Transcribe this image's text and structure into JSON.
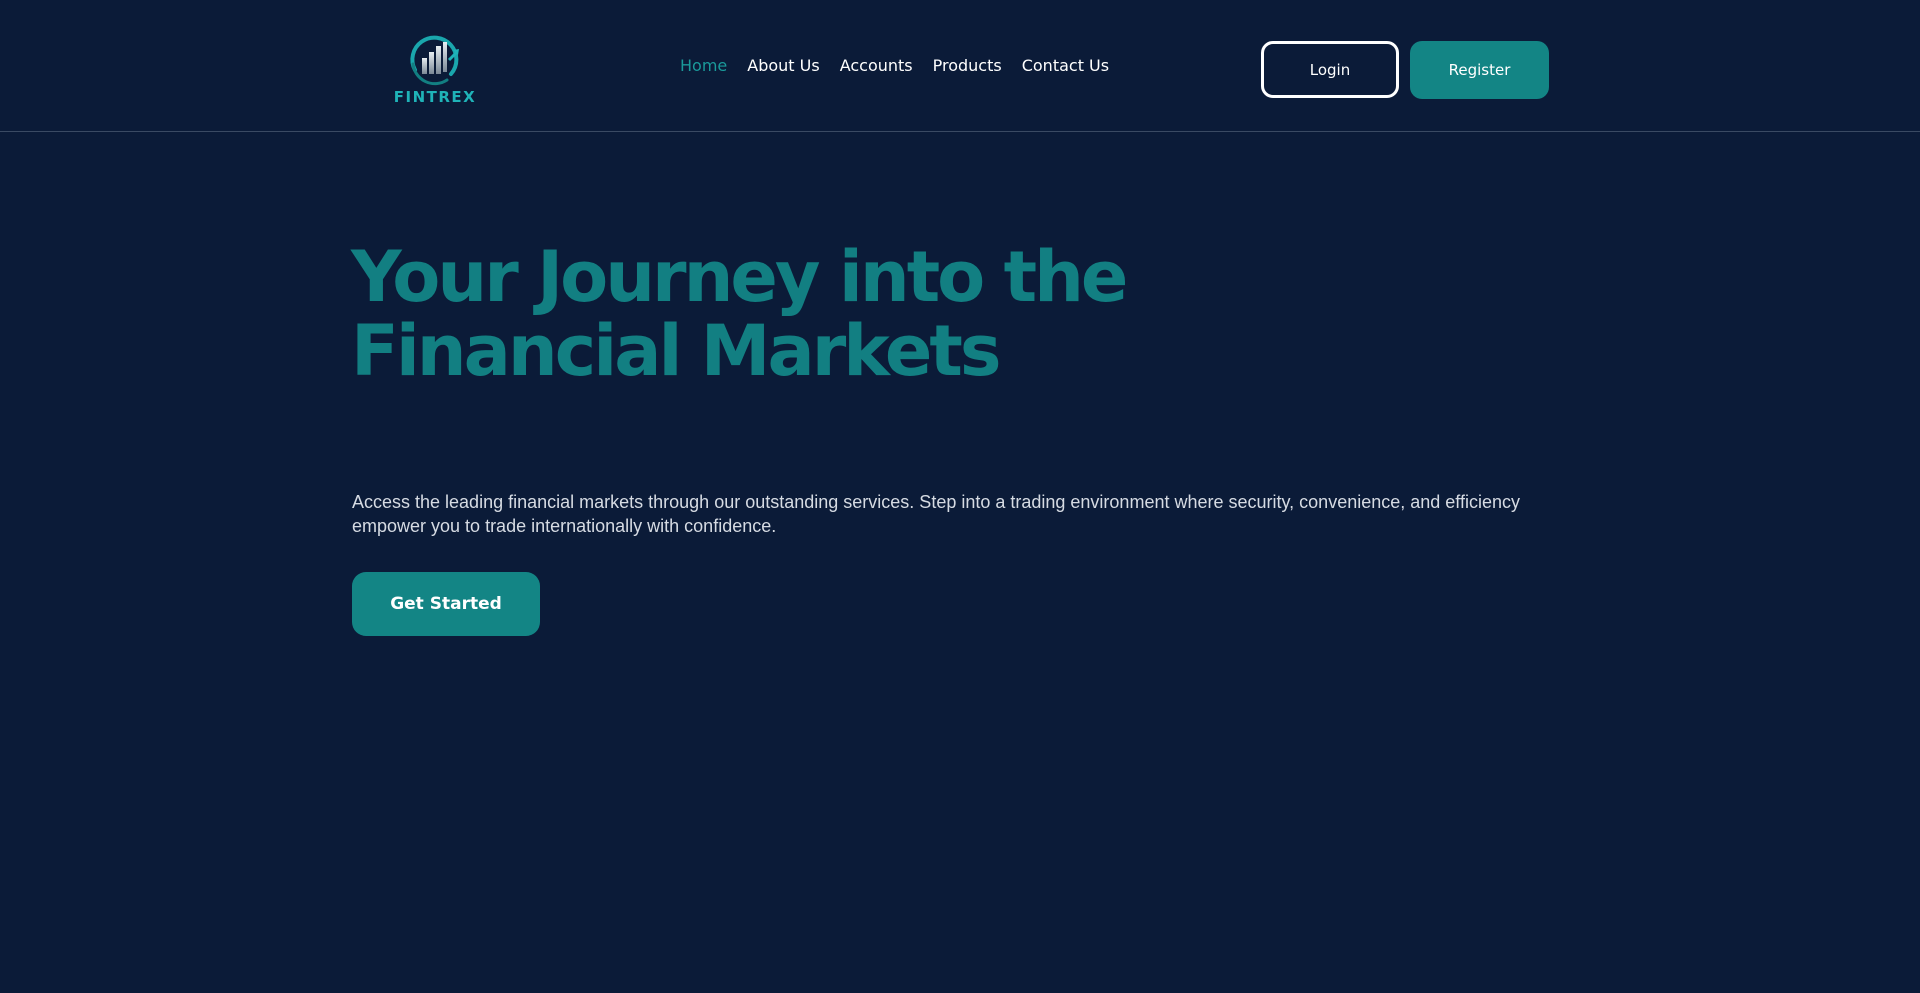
{
  "brand": {
    "name": "FINTREX",
    "logo_icon": "chart-growth-icon",
    "accent_color": "#1fb3b8"
  },
  "nav": {
    "items": [
      {
        "label": "Home",
        "active": true
      },
      {
        "label": "About Us",
        "active": false
      },
      {
        "label": "Accounts",
        "active": false
      },
      {
        "label": "Products",
        "active": false
      },
      {
        "label": "Contact Us",
        "active": false
      }
    ]
  },
  "auth": {
    "login_label": "Login",
    "register_label": "Register"
  },
  "hero": {
    "title": "Your Journey into the Financial Markets",
    "description": "Access the leading financial markets through our outstanding services. Step into a trading environment where security, convenience, and efficiency empower you to trade internationally with confidence.",
    "cta_label": "Get Started"
  },
  "colors": {
    "background": "#0b1b38",
    "primary": "#138585",
    "title": "#127f82",
    "active_nav": "#1a9a9a"
  }
}
